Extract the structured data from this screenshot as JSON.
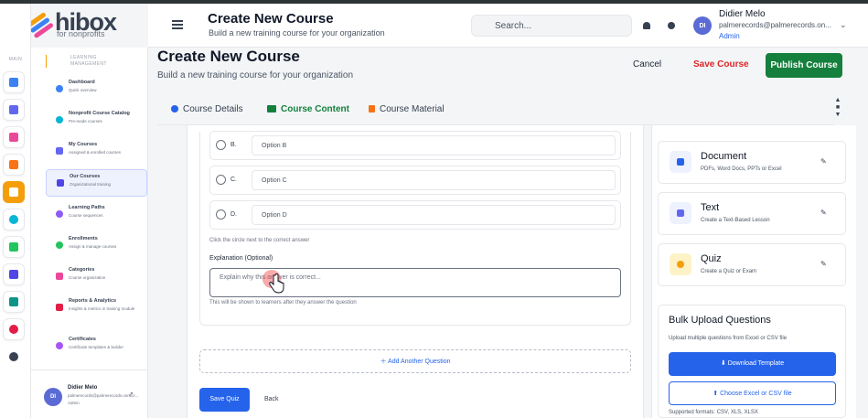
{
  "brand": {
    "name": "hibox",
    "tagline": "for nonprofits"
  },
  "rail": {
    "main_label": "MAIN"
  },
  "nav": {
    "section_label": "LEARNING MANAGEMENT",
    "items": [
      {
        "title": "Dashboard",
        "sub": "Quick overview",
        "color": "#3b82f6"
      },
      {
        "title": "Nonprofit Course Catalog",
        "sub": "Pre-made courses",
        "color": "#06b6d4"
      },
      {
        "title": "My Courses",
        "sub": "Assigned & enrolled courses",
        "color": "#6366f1"
      },
      {
        "title": "Our Courses",
        "sub": "Organizational training",
        "color": "#4f46e5"
      },
      {
        "title": "Learning Paths",
        "sub": "Course sequences",
        "color": "#8b5cf6"
      },
      {
        "title": "Enrollments",
        "sub": "Assign & manage courses",
        "color": "#22c55e"
      },
      {
        "title": "Categories",
        "sub": "Course organization",
        "color": "#ec4899"
      },
      {
        "title": "Reports & Analytics",
        "sub": "Insights & metrics in training module",
        "color": "#e11d48"
      },
      {
        "title": "Certificates",
        "sub": "Certificate templates & builder",
        "color": "#a855f7"
      }
    ],
    "user": {
      "initials": "DI",
      "name": "Didier Melo",
      "email": "palmerecords@palmerecords.onmicr...",
      "role": "Admin"
    }
  },
  "header": {
    "title": "Create New Course",
    "subtitle": "Build a new training course for your organization",
    "search_placeholder": "Search...",
    "user": {
      "initials": "DI",
      "name": "Didier Melo",
      "email": "palmerecords@palmerecords.on...",
      "role": "Admin"
    }
  },
  "page": {
    "title": "Create New Course",
    "subtitle": "Build a new training course for your organization",
    "cancel_label": "Cancel",
    "save_label": "Save Course",
    "publish_label": "Publish Course",
    "tabs": [
      {
        "label": "Course Details"
      },
      {
        "label": "Course Content"
      },
      {
        "label": "Course Material"
      }
    ]
  },
  "question": {
    "options": [
      {
        "letter": "B.",
        "placeholder": "Option B"
      },
      {
        "letter": "C.",
        "placeholder": "Option C"
      },
      {
        "letter": "D.",
        "placeholder": "Option D"
      }
    ],
    "correct_hint": "Click the circle next to the correct answer",
    "explanation_label": "Explanation (Optional)",
    "explanation_placeholder": "Explain why this answer is correct...",
    "explanation_hint": "This will be shown to learners after they answer the question",
    "add_question_label": "Add Another Question",
    "save_quiz_label": "Save Quiz",
    "back_label": "Back"
  },
  "lesson_types": [
    {
      "title": "Document",
      "sub": "PDFs, Word Docs, PPTs or Excel",
      "color": "#2563eb",
      "bg": "#eef2ff"
    },
    {
      "title": "Text",
      "sub": "Create a Text-Based Lesson",
      "color": "#6366f1",
      "bg": "#eef2ff"
    },
    {
      "title": "Quiz",
      "sub": "Create a Quiz or Exam",
      "color": "#f59e0b",
      "bg": "#fef3c7"
    }
  ],
  "bulk": {
    "title": "Bulk Upload Questions",
    "sub": "Upload multiple questions from Excel or CSV file",
    "download_label": "Download Template",
    "choose_label": "Choose Excel or CSV file",
    "formats": "Supported formats: CSV, XLS, XLSX"
  }
}
